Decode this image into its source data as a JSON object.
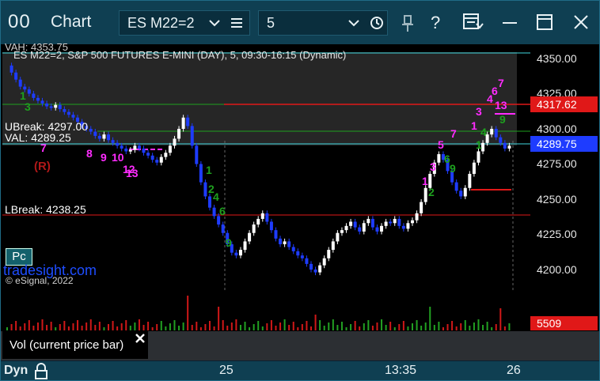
{
  "window": {
    "logo_text": "00",
    "title": "Chart"
  },
  "toolbar": {
    "symbol_value": "ES M22=2",
    "interval_value": "5",
    "icons": [
      "chevron-down-icon",
      "menu-icon",
      "chevron-down-icon",
      "clock-icon",
      "pin-icon",
      "help-icon",
      "layout-dropdown-icon",
      "minimize-icon",
      "maximize-icon",
      "close-icon"
    ]
  },
  "chart": {
    "header": "ES M22=2, S&P 500 FUTURES E-MINI (DAY), 5, 09:30-16:15 (Dynamic)",
    "vah_label": "VAH: 4353.75",
    "ubreak_label": "UBreak: 4297.00",
    "val_label": "VAL: 4289.25",
    "lbreak_label": "LBreak: 4238.25",
    "r_marker": "(R)",
    "pc_button": "Pc",
    "watermark": "tradesight.com",
    "copyright": "© eSignal, 2022",
    "price_ticks": [
      "4350.00",
      "4325.00",
      "4300.00",
      "4275.00",
      "4250.00",
      "4225.00",
      "4200.00"
    ],
    "price_tags": {
      "red": "4317.62",
      "blue": "4289.75"
    },
    "volume_tag": "5509",
    "colors": {
      "up": "#ffffff",
      "down": "#1e3cff",
      "magenta": "#ff2cff",
      "green": "#1ea01e",
      "red": "#e01818",
      "cyan": "#40d8e0"
    }
  },
  "volume_pane": {
    "tooltip": "Vol (current price bar)"
  },
  "xaxis": {
    "mode": "Dyn",
    "labels": [
      "25",
      "13:35",
      "26"
    ]
  }
}
